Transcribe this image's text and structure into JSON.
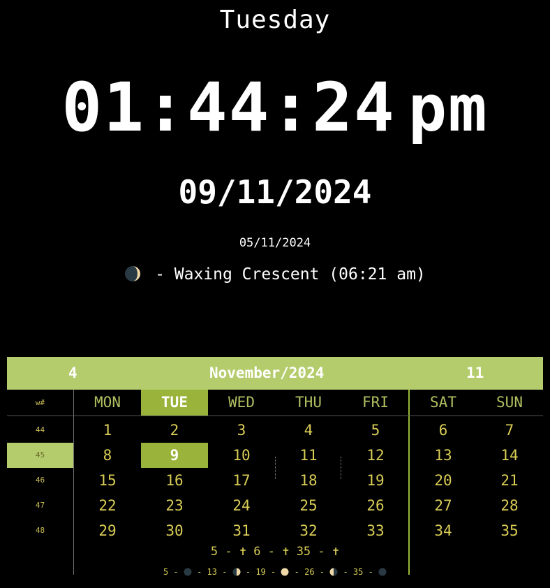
{
  "header": {
    "day_name": "Tuesday",
    "time": "01:44:24",
    "ampm": "pm",
    "date": "09/11/2024",
    "alt_date": "05/11/2024",
    "moon_phase": "- Waxing Crescent (06:21 am)",
    "moon_icon": "waxing-crescent-moon-icon"
  },
  "calendar": {
    "head_left": "4",
    "month_year": "November/2024",
    "head_right": "11",
    "week_col_label": "w#",
    "day_headers": [
      "MON",
      "TUE",
      "WED",
      "THU",
      "FRI",
      "SAT",
      "SUN"
    ],
    "selected_day_header": "TUE",
    "week_numbers": [
      "44",
      "45",
      "46",
      "47",
      "48"
    ],
    "selected_week": "45",
    "rows": [
      [
        "1",
        "2",
        "3",
        "4",
        "5",
        "6",
        "7"
      ],
      [
        "8",
        "9",
        "10",
        "11",
        "12",
        "13",
        "14"
      ],
      [
        "15",
        "16",
        "17",
        "18",
        "19",
        "20",
        "21"
      ],
      [
        "22",
        "23",
        "24",
        "25",
        "26",
        "27",
        "28"
      ],
      [
        "29",
        "30",
        "31",
        "32",
        "33",
        "34",
        "35"
      ]
    ],
    "selected_day": "9",
    "accent_color": "#9ab33a",
    "header_color": "#b5cc6c",
    "day_text_color": "#d9cd55"
  },
  "footer": {
    "holidays_line": "5 - ✝ 6 - ✝ 35 - ✝",
    "moon_line": {
      "items": [
        {
          "day": "5",
          "icon": "new-moon-icon"
        },
        {
          "day": "13",
          "icon": "first-quarter-moon-icon"
        },
        {
          "day": "19",
          "icon": "full-moon-icon"
        },
        {
          "day": "26",
          "icon": "last-quarter-moon-icon"
        },
        {
          "day": "35",
          "icon": "new-moon-icon"
        }
      ]
    }
  }
}
